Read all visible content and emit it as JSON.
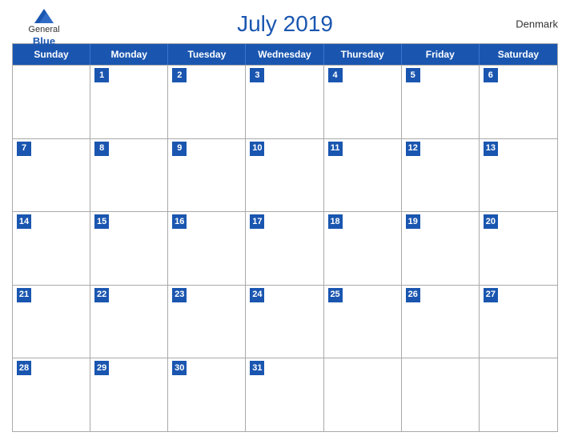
{
  "header": {
    "logo": {
      "general": "General",
      "blue": "Blue",
      "icon_color": "#1a56b0"
    },
    "title": "July 2019",
    "country": "Denmark"
  },
  "calendar": {
    "days": [
      "Sunday",
      "Monday",
      "Tuesday",
      "Wednesday",
      "Thursday",
      "Friday",
      "Saturday"
    ],
    "weeks": [
      [
        null,
        1,
        2,
        3,
        4,
        5,
        6
      ],
      [
        7,
        8,
        9,
        10,
        11,
        12,
        13
      ],
      [
        14,
        15,
        16,
        17,
        18,
        19,
        20
      ],
      [
        21,
        22,
        23,
        24,
        25,
        26,
        27
      ],
      [
        28,
        29,
        30,
        31,
        null,
        null,
        null
      ]
    ]
  }
}
